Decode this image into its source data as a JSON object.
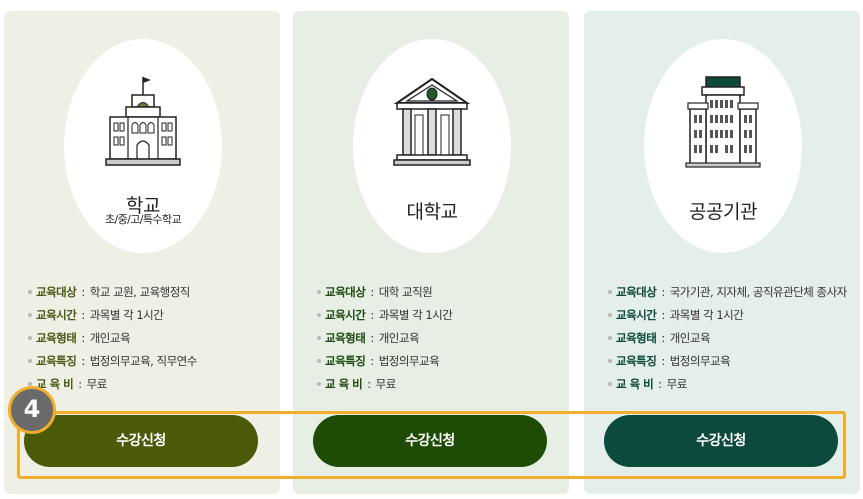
{
  "cards": [
    {
      "title": "학교",
      "subtitle": "초/중/고/특수학교",
      "bg": "#efefe5",
      "button_color": "#4a5a09",
      "icon": "school-building-icon",
      "rows": [
        {
          "key": "교육대상",
          "value": "학교 교원, 교육행정직"
        },
        {
          "key": "교육시간",
          "value": "과목별 각 1시간"
        },
        {
          "key": "교육형태",
          "value": "개인교육"
        },
        {
          "key": "교육특징",
          "value": "법정의무교육, 직무연수"
        },
        {
          "key": "교 육 비",
          "value": "무료"
        }
      ],
      "button_label": "수강신청"
    },
    {
      "title": "대학교",
      "subtitle": "",
      "bg": "#e7efe4",
      "button_color": "#1e4b06",
      "icon": "university-building-icon",
      "rows": [
        {
          "key": "교육대상",
          "value": "대학 교직원"
        },
        {
          "key": "교육시간",
          "value": "과목별 각 1시간"
        },
        {
          "key": "교육형태",
          "value": "개인교육"
        },
        {
          "key": "교육특징",
          "value": "법정의무교육"
        },
        {
          "key": "교 육 비",
          "value": "무료"
        }
      ],
      "button_label": "수강신청"
    },
    {
      "title": "공공기관",
      "subtitle": "",
      "bg": "#e4eeea",
      "button_color": "#0b4a3c",
      "icon": "public-office-building-icon",
      "rows": [
        {
          "key": "교육대상",
          "value": "국가기관, 지자체, 공직유관단체 종사자"
        },
        {
          "key": "교육시간",
          "value": "과목별 각 1시간"
        },
        {
          "key": "교육형태",
          "value": "개인교육"
        },
        {
          "key": "교육특징",
          "value": "법정의무교육"
        },
        {
          "key": "교 육 비",
          "value": "무료"
        }
      ],
      "button_label": "수강신청"
    }
  ],
  "annotation": {
    "step_number": "4",
    "highlight_color": "#f0ad2e"
  }
}
